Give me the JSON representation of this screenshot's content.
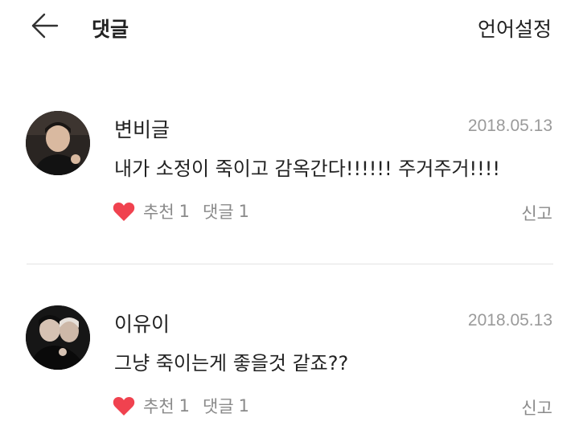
{
  "header": {
    "back_icon": "arrow-left-icon",
    "title": "댓글",
    "language_label": "언어설정"
  },
  "comments": [
    {
      "author": "변비글",
      "date": "2018.05.13",
      "text": "내가 소정이 죽이고 감옥간다!!!!!! 주거주거!!!!",
      "like_label": "추천",
      "like_count": "1",
      "reply_label": "댓글",
      "reply_count": "1",
      "report_label": "신고"
    },
    {
      "author": "이유이",
      "date": "2018.05.13",
      "text": "그냥 죽이는게 좋을것 같죠??",
      "like_label": "추천",
      "like_count": "1",
      "reply_label": "댓글",
      "reply_count": "1",
      "report_label": "신고"
    }
  ],
  "colors": {
    "heart": "#f0424f",
    "meta_text": "#8a8a8a",
    "date_text": "#9a9a9a",
    "divider": "#e3e3e3"
  }
}
